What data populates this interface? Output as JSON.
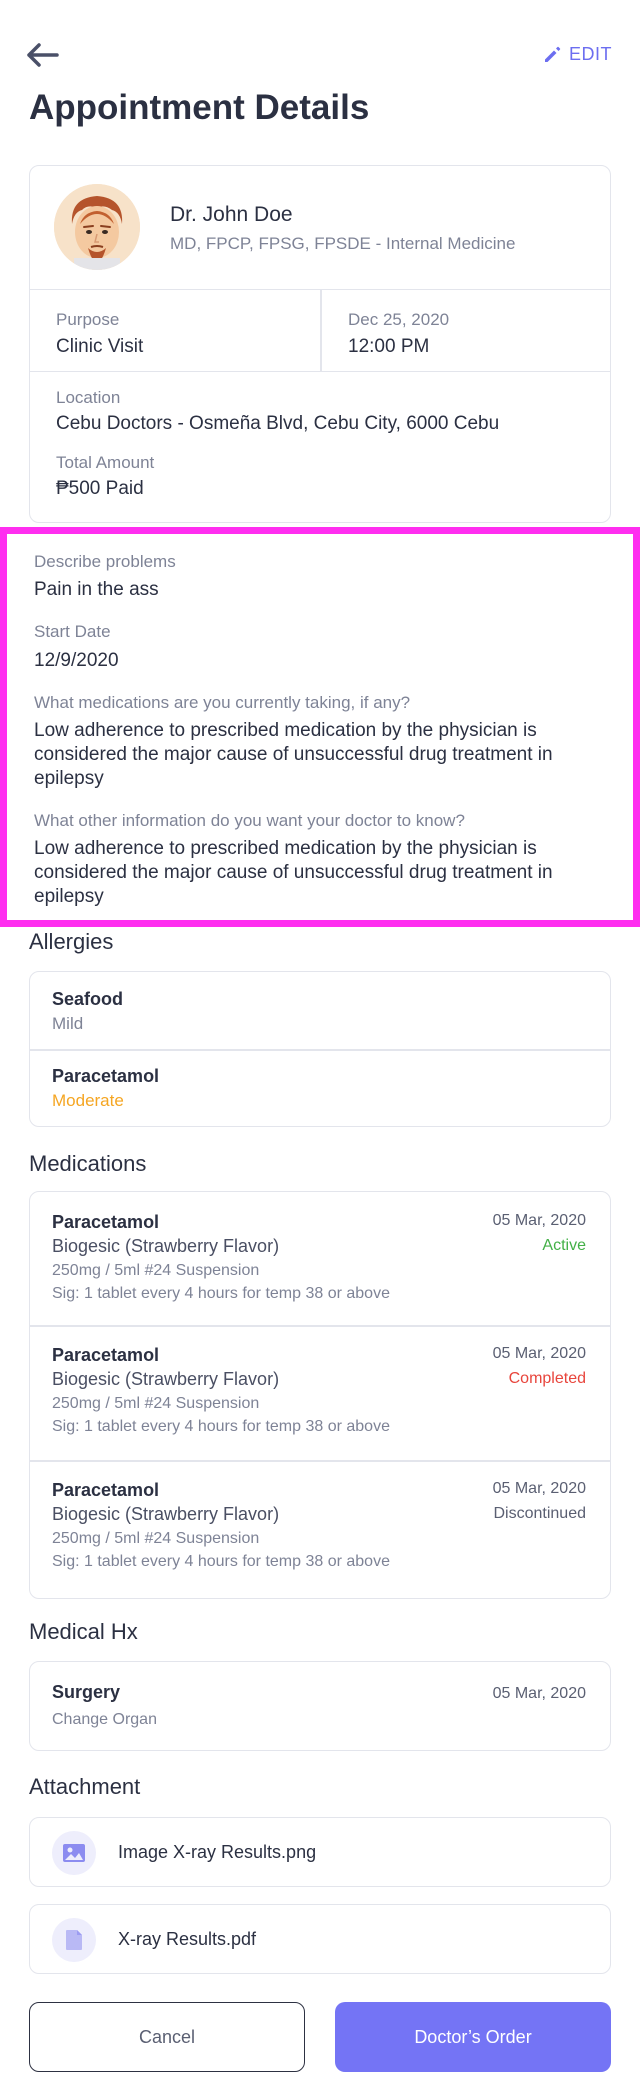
{
  "header": {
    "edit_label": "EDIT",
    "title": "Appointment Details"
  },
  "doctor": {
    "name": "Dr. John Doe",
    "credentials": "MD, FPCP, FPSG, FPSDE - Internal Medicine",
    "purpose_label": "Purpose",
    "purpose_value": "Clinic Visit",
    "date": "Dec 25, 2020",
    "time": "12:00 PM",
    "location_label": "Location",
    "location_value": "Cebu Doctors - Osmeña Blvd, Cebu City, 6000 Cebu",
    "amount_label": "Total Amount",
    "amount_value": "₱500 Paid"
  },
  "details": {
    "problem_label": "Describe problems",
    "problem_value": "Pain in the ass",
    "start_label": "Start Date",
    "start_value": "12/9/2020",
    "meds_label": "What medications are you currently taking, if any?",
    "meds_value": "Low adherence to prescribed medication by the physician is considered the major cause of unsuccessful drug treatment in epilepsy",
    "other_label": "What other information do you want your doctor to know?",
    "other_value": "Low adherence to prescribed medication by the physician is considered the major cause of unsuccessful drug treatment in epilepsy"
  },
  "allergies": {
    "title": "Allergies",
    "items": [
      {
        "name": "Seafood",
        "severity": "Mild",
        "color": "#7e8396"
      },
      {
        "name": "Paracetamol",
        "severity": "Moderate",
        "color": "#f5a623"
      }
    ]
  },
  "medications": {
    "title": "Medications",
    "items": [
      {
        "name": "Paracetamol",
        "brand": "Biogesic (Strawberry Flavor)",
        "dose": "250mg / 5ml #24 Suspension",
        "sig": "Sig: 1 tablet every 4 hours for temp 38 or above",
        "date": "05 Mar, 2020",
        "status": "Active",
        "status_color": "#43b047"
      },
      {
        "name": "Paracetamol",
        "brand": "Biogesic (Strawberry Flavor)",
        "dose": "250mg / 5ml #24 Suspension",
        "sig": "Sig: 1 tablet every 4 hours for temp 38 or above",
        "date": "05 Mar, 2020",
        "status": "Completed",
        "status_color": "#e8453c"
      },
      {
        "name": "Paracetamol",
        "brand": "Biogesic (Strawberry Flavor)",
        "dose": "250mg / 5ml #24 Suspension",
        "sig": "Sig: 1 tablet every 4 hours for temp 38 or above",
        "date": "05 Mar, 2020",
        "status": "Discontinued",
        "status_color": "#5a5f72"
      }
    ]
  },
  "medical_hx": {
    "title": "Medical Hx",
    "item": {
      "name": "Surgery",
      "detail": "Change Organ",
      "date": "05 Mar, 2020"
    }
  },
  "attachments": {
    "title": "Attachment",
    "items": [
      {
        "name": "Image X-ray Results.png",
        "icon": "image-icon"
      },
      {
        "name": "X-ray Results.pdf",
        "icon": "file-icon"
      }
    ]
  },
  "footer": {
    "cancel_label": "Cancel",
    "order_label": "Doctor’s Order"
  },
  "colors": {
    "accent": "#7474f5",
    "highlight_border": "#ff2ef0",
    "border": "#e3e5ec"
  }
}
